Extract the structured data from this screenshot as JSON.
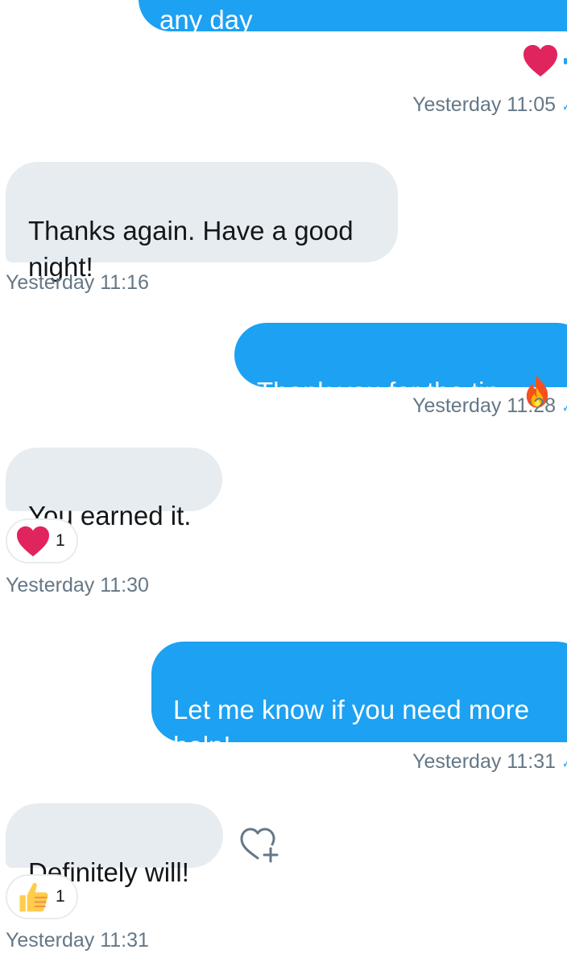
{
  "colors": {
    "outgoing": "#1da1f2",
    "incoming": "#e6ecf0",
    "heart": "#e0245e",
    "timestamp": "#657786"
  },
  "messages": [
    {
      "direction": "outgoing",
      "text": "any day"
    },
    {
      "direction": "outgoing",
      "reaction": "heart-icon",
      "timestamp": "Yesterday 11:05"
    },
    {
      "direction": "incoming",
      "text": "Thanks again. Have a good\nnight!",
      "timestamp": "Yesterday 11:16"
    },
    {
      "direction": "outgoing",
      "text": "Thank you for the tip",
      "emoji": "fire-icon",
      "timestamp": "Yesterday 11:28"
    },
    {
      "direction": "incoming",
      "text": "You earned it.",
      "reaction": {
        "icon": "heart-icon",
        "count": "1"
      },
      "timestamp": "Yesterday 11:30"
    },
    {
      "direction": "outgoing",
      "text": "Let me know if you need more\nhelp!",
      "timestamp": "Yesterday 11:31"
    },
    {
      "direction": "incoming",
      "text": "Definitely will!",
      "reaction": {
        "icon": "thumbs-up-icon",
        "count": "1"
      },
      "action": "add-reaction-icon",
      "timestamp": "Yesterday 11:31"
    }
  ]
}
